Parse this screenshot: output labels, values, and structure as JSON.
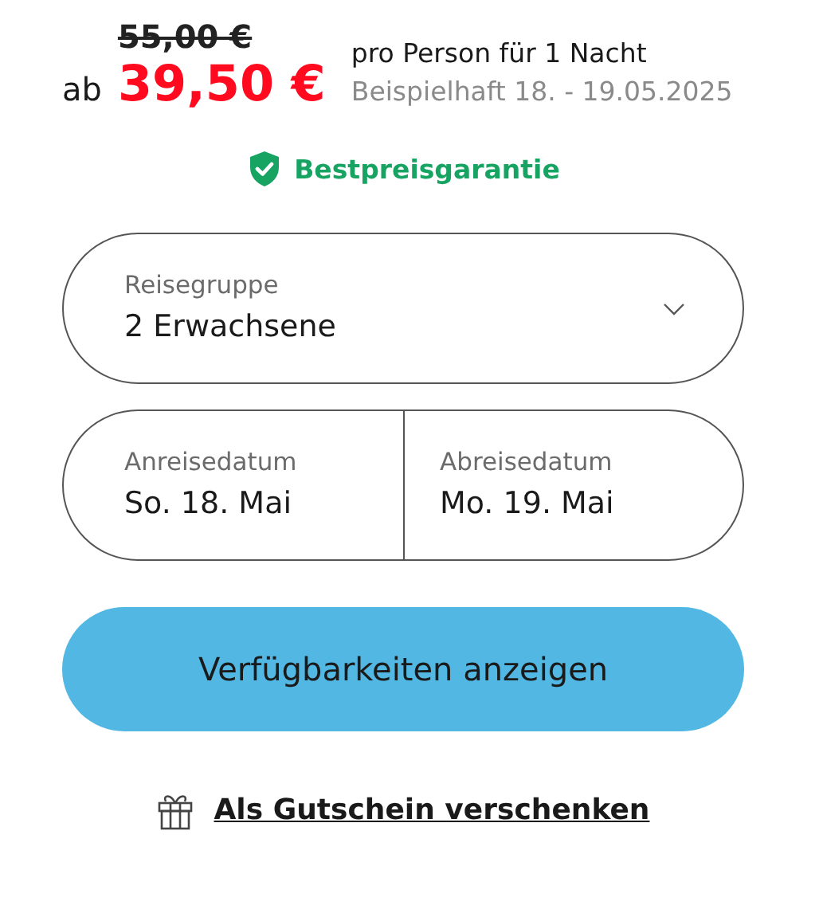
{
  "price": {
    "old": "55,00 €",
    "prefix": "ab",
    "current": "39,50 €",
    "per": "pro Person für 1 Nacht",
    "example": "Beispielhaft 18. - 19.05.2025"
  },
  "guarantee": {
    "label": "Bestpreisgarantie"
  },
  "travel_group": {
    "label": "Reisegruppe",
    "value": "2 Erwachsene"
  },
  "dates": [
    {
      "label": "Anreisedatum",
      "value": "So. 18. Mai"
    },
    {
      "label": "Abreisedatum",
      "value": "Mo. 19. Mai"
    }
  ],
  "button": {
    "label": "Verfügbarkeiten anzeigen"
  },
  "gift_link": {
    "label": "Als Gutschein verschenken"
  }
}
